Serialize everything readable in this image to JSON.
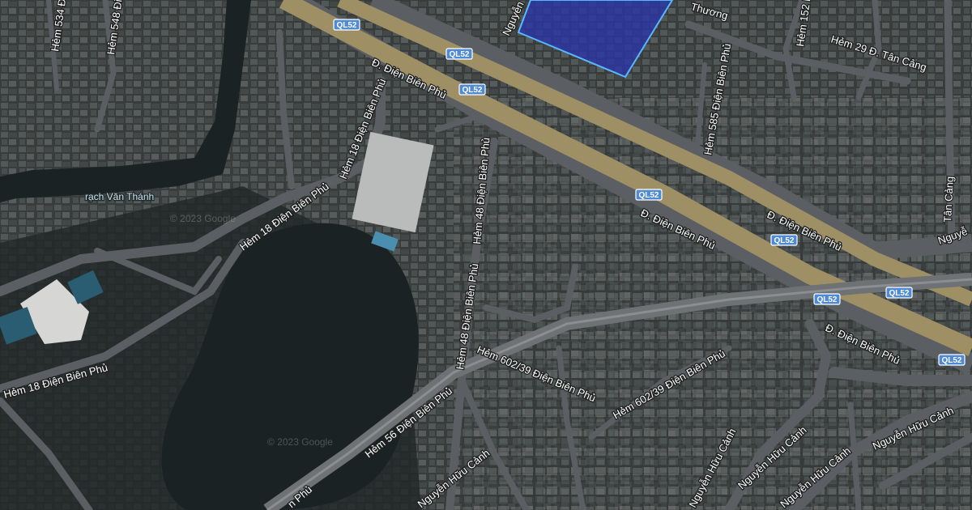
{
  "colors": {
    "imagery": "#2f3433",
    "water": "#1a2224",
    "road": "#5b5f63",
    "highway": "#9f8f64",
    "shield": "#4f8ad6",
    "highlight": "#2b36a8",
    "highlight_outline": "#58b8ff"
  },
  "route_shields": [
    "QL52",
    "QL52",
    "QL52",
    "QL52",
    "QL52",
    "QL52",
    "QL52",
    "QL52"
  ],
  "street_labels": [
    "Hẻm 534 Đ...",
    "Hẻm 548 Đi...",
    "Nguyễn",
    "Thương",
    "Hẻm 152 N",
    "Hẻm 29 Đ. Tân Cảng",
    "Đ. Điện Biên Phủ",
    "Hẻm 585 Điện Biên Phủ",
    "Hẻm 18 Điện Biên Phủ",
    "Hẻm 48 Điện Biên Phủ",
    "Đ. Điện Biên Phủ",
    "Tân Cảng",
    "Hẻm 18 Điện Biên Phủ",
    "Đ. Điện Biên Phủ",
    "Nguyễ",
    "Hẻm 48 Điện Biên Phủ",
    "Hẻm 602/39 Điện Biên Phủ",
    "Đ. Điện Biên Phủ",
    "Hẻm 18 Điện Biên Phủ",
    "Hẻm 602/39 Điện Biên Phủ",
    "Hẻm 56 Điện Biên Phủ",
    "Nguyễn Hữu Cảnh",
    "Nguyễn Hữu Cảnh",
    "Nguyễn Hữu Cảnh",
    "Nguyễn Hữu Cảnh",
    "Nguyễn Hữu Cảnh",
    "n Phủ"
  ],
  "water_label": "rạch Văn Thánh",
  "watermarks": [
    "© 2023 Google",
    "© 2023 Google"
  ]
}
